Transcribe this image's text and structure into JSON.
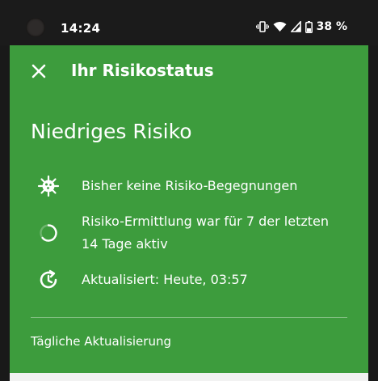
{
  "status_bar": {
    "time": "14:24",
    "battery_percent": "38 %",
    "icons": [
      "vibrate-icon",
      "wifi-icon",
      "signal-icon",
      "battery-icon"
    ]
  },
  "header": {
    "title": "Ihr Risikostatus",
    "close_icon": "close-icon"
  },
  "risk": {
    "level_title": "Niedriges Risiko",
    "items": [
      {
        "icon": "virus-icon",
        "text": "Bisher keine Risiko-Begegnungen"
      },
      {
        "icon": "progress-circle-icon",
        "text": "Risiko-Ermittlung war für 7 der letzten 14 Tage aktiv"
      },
      {
        "icon": "clock-refresh-icon",
        "text": "Aktualisiert: Heute, 03:57"
      }
    ]
  },
  "footer": {
    "daily_update_label": "Tägliche Aktualisierung"
  },
  "colors": {
    "card_green": "#3d9c3d",
    "status_bar_bg": "#1b1b1b",
    "text": "#ffffff"
  }
}
